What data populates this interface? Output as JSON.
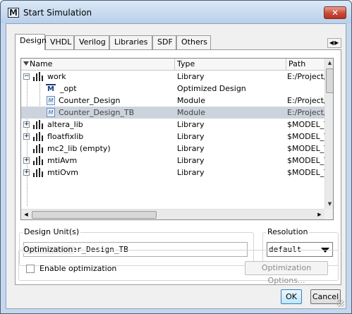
{
  "window": {
    "title": "Start Simulation",
    "close_glyph": "✕",
    "app_icon": "M"
  },
  "tabs": [
    {
      "label": "Design",
      "active": true
    },
    {
      "label": "VHDL",
      "active": false
    },
    {
      "label": "Verilog",
      "active": false
    },
    {
      "label": "Libraries",
      "active": false
    },
    {
      "label": "SDF",
      "active": false
    },
    {
      "label": "Others",
      "active": false
    }
  ],
  "tab_scroll": "◀▶",
  "grid": {
    "columns": [
      "Name",
      "Type",
      "Path"
    ],
    "rows": [
      {
        "name": "work",
        "type": "Library",
        "path": "E:/Project/",
        "icon": "library-icon",
        "expander": "−",
        "level": 0
      },
      {
        "name": "_opt",
        "type": "Optimized Design",
        "path": "",
        "icon": "optimized-design-icon",
        "expander": "",
        "level": 1
      },
      {
        "name": "Counter_Design",
        "type": "Module",
        "path": "E:/Project/",
        "icon": "module-icon",
        "expander": "",
        "level": 1
      },
      {
        "name": "Counter_Design_TB",
        "type": "Module",
        "path": "E:/Project/",
        "icon": "module-icon",
        "expander": "",
        "level": 1,
        "selected": true
      },
      {
        "name": "altera_lib",
        "type": "Library",
        "path": "$MODEL_T",
        "icon": "library-icon",
        "expander": "+",
        "level": 0
      },
      {
        "name": "floatfixlib",
        "type": "Library",
        "path": "$MODEL_T",
        "icon": "library-icon",
        "expander": "+",
        "level": 0
      },
      {
        "name": "mc2_lib  (empty)",
        "type": "Library",
        "path": "$MODEL_T",
        "icon": "library-icon",
        "expander": "",
        "level": 0
      },
      {
        "name": "mtiAvm",
        "type": "Library",
        "path": "$MODEL_T",
        "icon": "library-icon",
        "expander": "+",
        "level": 0
      },
      {
        "name": "mtiOvm",
        "type": "Library",
        "path": "$MODEL_T",
        "icon": "library-icon",
        "expander": "+",
        "level": 0
      }
    ]
  },
  "design_unit": {
    "legend": "Design Unit(s)",
    "value": "work.Counter_Design_TB"
  },
  "resolution": {
    "legend": "Resolution",
    "value": "default"
  },
  "optimization": {
    "legend": "Optimization",
    "checkbox_label": "Enable optimization",
    "checked": false,
    "options_button": "Optimization Options..."
  },
  "buttons": {
    "ok": "OK",
    "cancel": "Cancel"
  }
}
